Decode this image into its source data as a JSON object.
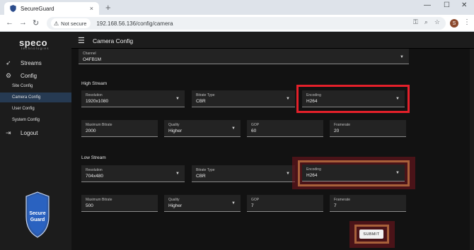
{
  "browser": {
    "tab_title": "SecureGuard",
    "tab_close": "×",
    "new_tab": "+",
    "minimize": "—",
    "maximize": "☐",
    "close": "✕",
    "not_secure": "Not secure",
    "url": "192.168.56.136/config/camera",
    "profile_initial": "S",
    "icons": [
      "back-icon",
      "forward-icon",
      "reload-icon",
      "key-icon",
      "zoom-icon",
      "star-icon",
      "profile-icon",
      "menu-icon"
    ]
  },
  "sidebar": {
    "logo": "speco",
    "logo_sub": "technologies",
    "streams": "Streams",
    "config": "Config",
    "site_config": "Site Config",
    "camera_config": "Camera Config",
    "user_config": "User Config",
    "system_config": "System Config",
    "logout": "Logout",
    "badge_line1": "Secure",
    "badge_line2": "Guard"
  },
  "appbar": {
    "title": "Camera Config"
  },
  "form": {
    "channel": {
      "label": "Channel",
      "value": "O4FB1M"
    },
    "high_stream": {
      "title": "High Stream",
      "resolution": {
        "label": "Resolution",
        "value": "1920x1080"
      },
      "bitrate_type": {
        "label": "Bitrate Type",
        "value": "CBR"
      },
      "encoding": {
        "label": "Encoding",
        "value": "H264"
      },
      "max_bitrate": {
        "label": "Maximum Bitrate",
        "value": "2000"
      },
      "quality": {
        "label": "Quality",
        "value": "Higher"
      },
      "gop": {
        "label": "GOP",
        "value": "60"
      },
      "framerate": {
        "label": "Framerate",
        "value": "20"
      }
    },
    "low_stream": {
      "title": "Low Stream",
      "resolution": {
        "label": "Resolution",
        "value": "704x480"
      },
      "bitrate_type": {
        "label": "Bitrate Type",
        "value": "CBR"
      },
      "encoding": {
        "label": "Encoding",
        "value": "H264"
      },
      "max_bitrate": {
        "label": "Maximum Bitrate",
        "value": "500"
      },
      "quality": {
        "label": "Quality",
        "value": "Higher"
      },
      "gop": {
        "label": "GOP",
        "value": "7"
      },
      "framerate": {
        "label": "Framerate",
        "value": "7"
      }
    },
    "submit": "SUBMIT"
  },
  "colors": {
    "highlight_red": "#e4202a",
    "highlight_brown": "#a8603a",
    "active_nav": "#263a52"
  }
}
